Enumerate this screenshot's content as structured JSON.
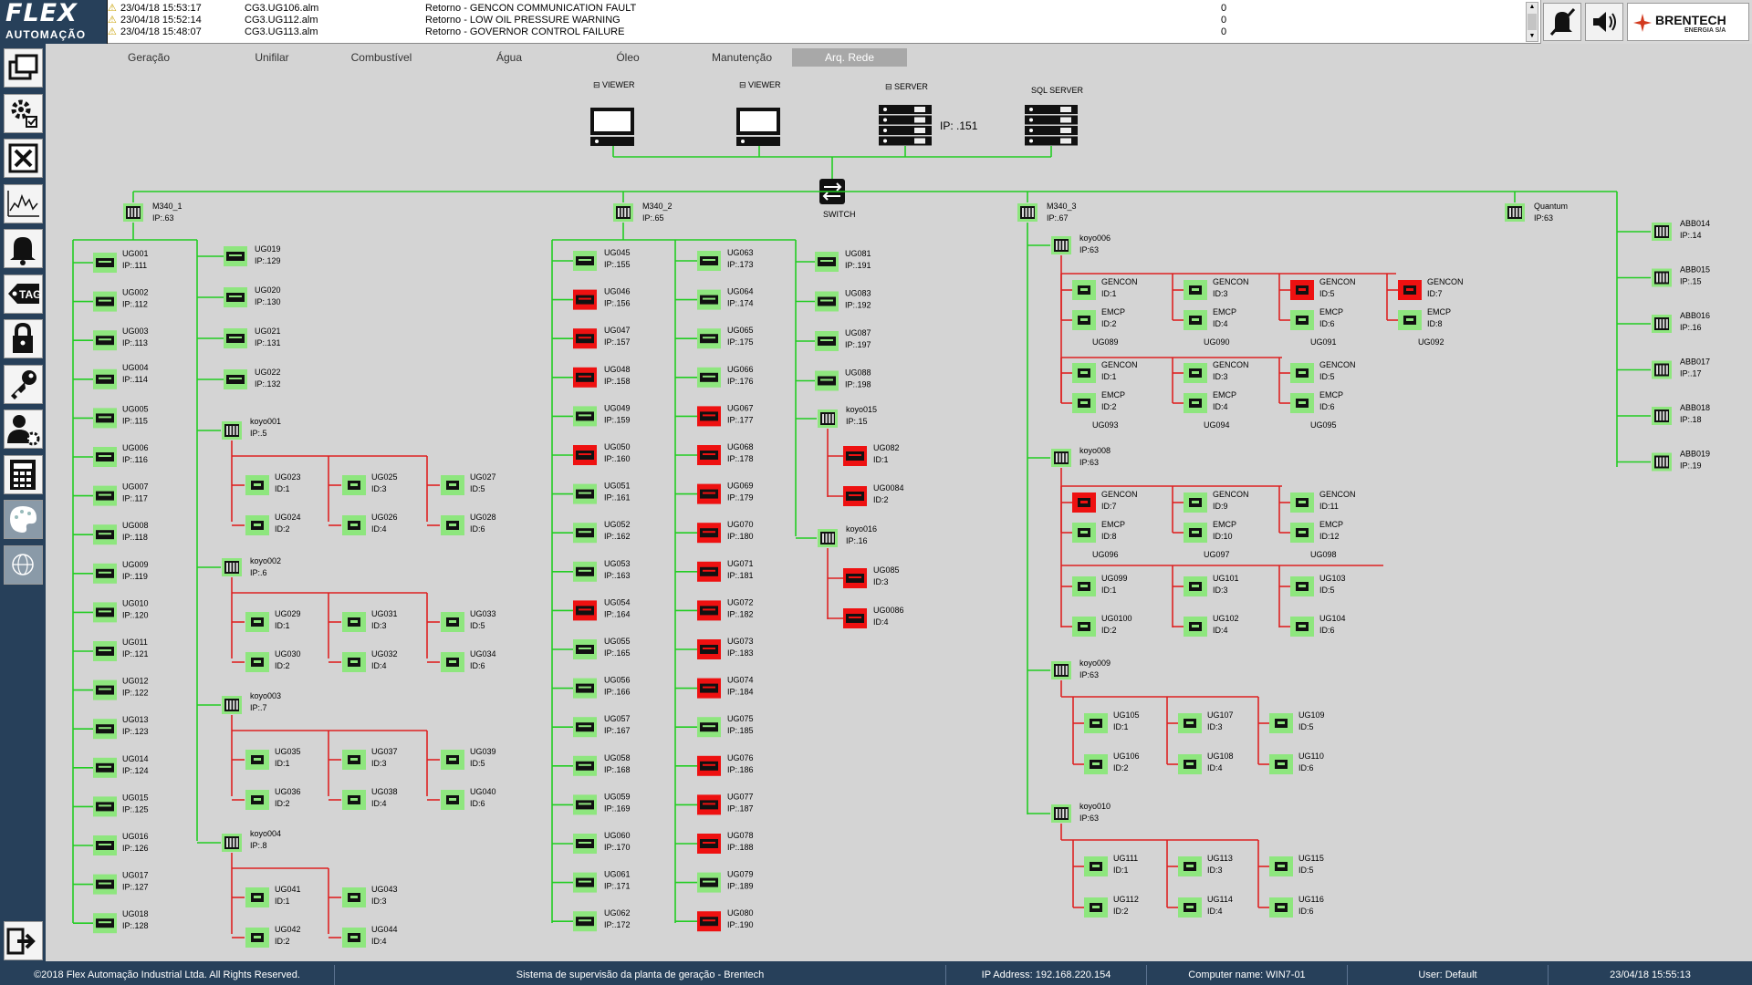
{
  "logo": {
    "line1": "FLEX",
    "line2": "AUTOMAÇÃO"
  },
  "alarms": [
    {
      "timestamp": "23/04/18 15:53:17",
      "tag": "CG3.UG106.alm",
      "message": "Retorno - GENCON COMMUNICATION FAULT",
      "value": "0"
    },
    {
      "timestamp": "23/04/18 15:52:14",
      "tag": "CG3.UG112.alm",
      "message": "Retorno - LOW OIL PRESSURE WARNING",
      "value": "0"
    },
    {
      "timestamp": "23/04/18 15:48:07",
      "tag": "CG3.UG113.alm",
      "message": "Retorno - GOVERNOR CONTROL FAILURE",
      "value": "0"
    }
  ],
  "brand": {
    "name": "BRENTECH",
    "sub": "ENERGIA S/A"
  },
  "tabs": [
    "Geração",
    "Unifilar",
    "Combustível",
    "Água",
    "Óleo",
    "Manutenção",
    "Arq. Rede"
  ],
  "active_tab": "Arq. Rede",
  "sidebar_icons": [
    "windows-icon",
    "gear-check-icon",
    "excel-icon",
    "trend-chart-icon",
    "bell-icon",
    "tag-icon",
    "lock-icon",
    "key-icon",
    "user-settings-icon",
    "calculator-icon",
    "palette-icon",
    "globe-icon",
    "exit-icon"
  ],
  "colors": {
    "ok": "#8ee67e",
    "fault": "#ee1111",
    "link_green": "#22cc22",
    "link_red": "#dd2222",
    "sidebar": "#27405a"
  },
  "servers": [
    {
      "label": "VIEWER",
      "kind": "viewer"
    },
    {
      "label": "VIEWER",
      "kind": "viewer"
    },
    {
      "label": "SERVER",
      "kind": "server",
      "ip": "IP: .151"
    },
    {
      "label": "SQL SERVER",
      "kind": "server"
    }
  ],
  "switch_label": "SWITCH",
  "plcs": [
    {
      "name": "M340_1",
      "ip": "IP:.63"
    },
    {
      "name": "M340_2",
      "ip": "IP:.65"
    },
    {
      "name": "M340_3",
      "ip": "IP:.67"
    },
    {
      "name": "Quantum",
      "ip": "IP:63"
    }
  ],
  "m340_1_units": [
    {
      "name": "UG001",
      "ip": "IP:.111",
      "status": "ok"
    },
    {
      "name": "UG002",
      "ip": "IP:.112",
      "status": "ok"
    },
    {
      "name": "UG003",
      "ip": "IP:.113",
      "status": "ok"
    },
    {
      "name": "UG004",
      "ip": "IP:.114",
      "status": "ok"
    },
    {
      "name": "UG005",
      "ip": "IP:.115",
      "status": "ok"
    },
    {
      "name": "UG006",
      "ip": "IP:.116",
      "status": "ok"
    },
    {
      "name": "UG007",
      "ip": "IP:.117",
      "status": "ok"
    },
    {
      "name": "UG008",
      "ip": "IP:.118",
      "status": "ok"
    },
    {
      "name": "UG009",
      "ip": "IP:.119",
      "status": "ok"
    },
    {
      "name": "UG010",
      "ip": "IP:.120",
      "status": "ok"
    },
    {
      "name": "UG011",
      "ip": "IP:.121",
      "status": "ok"
    },
    {
      "name": "UG012",
      "ip": "IP:.122",
      "status": "ok"
    },
    {
      "name": "UG013",
      "ip": "IP:.123",
      "status": "ok"
    },
    {
      "name": "UG014",
      "ip": "IP:.124",
      "status": "ok"
    },
    {
      "name": "UG015",
      "ip": "IP:.125",
      "status": "ok"
    },
    {
      "name": "UG016",
      "ip": "IP:.126",
      "status": "ok"
    },
    {
      "name": "UG017",
      "ip": "IP:.127",
      "status": "ok"
    },
    {
      "name": "UG018",
      "ip": "IP:.128",
      "status": "ok"
    }
  ],
  "m340_1_units_b": [
    {
      "name": "UG019",
      "ip": "IP:.129",
      "status": "ok"
    },
    {
      "name": "UG020",
      "ip": "IP:.130",
      "status": "ok"
    },
    {
      "name": "UG021",
      "ip": "IP:.131",
      "status": "ok"
    },
    {
      "name": "UG022",
      "ip": "IP:.132",
      "status": "ok"
    }
  ],
  "koyo_m1": [
    {
      "name": "koyo001",
      "ip": "IP:.5",
      "units": [
        {
          "name": "UG023",
          "id": "ID:1",
          "status": "ok"
        },
        {
          "name": "UG024",
          "id": "ID:2",
          "status": "ok"
        },
        {
          "name": "UG025",
          "id": "ID:3",
          "status": "ok"
        },
        {
          "name": "UG026",
          "id": "ID:4",
          "status": "ok"
        },
        {
          "name": "UG027",
          "id": "ID:5",
          "status": "ok"
        },
        {
          "name": "UG028",
          "id": "ID:6",
          "status": "ok"
        }
      ]
    },
    {
      "name": "koyo002",
      "ip": "IP:.6",
      "units": [
        {
          "name": "UG029",
          "id": "ID:1",
          "status": "ok"
        },
        {
          "name": "UG030",
          "id": "ID:2",
          "status": "ok"
        },
        {
          "name": "UG031",
          "id": "ID:3",
          "status": "ok"
        },
        {
          "name": "UG032",
          "id": "ID:4",
          "status": "ok"
        },
        {
          "name": "UG033",
          "id": "ID:5",
          "status": "ok"
        },
        {
          "name": "UG034",
          "id": "ID:6",
          "status": "ok"
        }
      ]
    },
    {
      "name": "koyo003",
      "ip": "IP:.7",
      "units": [
        {
          "name": "UG035",
          "id": "ID:1",
          "status": "ok"
        },
        {
          "name": "UG036",
          "id": "ID:2",
          "status": "ok"
        },
        {
          "name": "UG037",
          "id": "ID:3",
          "status": "ok"
        },
        {
          "name": "UG038",
          "id": "ID:4",
          "status": "ok"
        },
        {
          "name": "UG039",
          "id": "ID:5",
          "status": "ok"
        },
        {
          "name": "UG040",
          "id": "ID:6",
          "status": "ok"
        }
      ]
    },
    {
      "name": "koyo004",
      "ip": "IP:.8",
      "units": [
        {
          "name": "UG041",
          "id": "ID:1",
          "status": "ok"
        },
        {
          "name": "UG042",
          "id": "ID:2",
          "status": "ok"
        },
        {
          "name": "UG043",
          "id": "ID:3",
          "status": "ok"
        },
        {
          "name": "UG044",
          "id": "ID:4",
          "status": "ok"
        }
      ]
    }
  ],
  "m340_2_units_a": [
    {
      "name": "UG045",
      "ip": "IP:.155",
      "status": "ok"
    },
    {
      "name": "UG046",
      "ip": "IP:.156",
      "status": "fault"
    },
    {
      "name": "UG047",
      "ip": "IP:.157",
      "status": "fault"
    },
    {
      "name": "UG048",
      "ip": "IP:.158",
      "status": "fault"
    },
    {
      "name": "UG049",
      "ip": "IP:.159",
      "status": "ok"
    },
    {
      "name": "UG050",
      "ip": "IP:.160",
      "status": "fault"
    },
    {
      "name": "UG051",
      "ip": "IP:.161",
      "status": "ok"
    },
    {
      "name": "UG052",
      "ip": "IP:.162",
      "status": "ok"
    },
    {
      "name": "UG053",
      "ip": "IP:.163",
      "status": "ok"
    },
    {
      "name": "UG054",
      "ip": "IP:.164",
      "status": "fault"
    },
    {
      "name": "UG055",
      "ip": "IP:.165",
      "status": "ok"
    },
    {
      "name": "UG056",
      "ip": "IP:.166",
      "status": "ok"
    },
    {
      "name": "UG057",
      "ip": "IP:.167",
      "status": "ok"
    },
    {
      "name": "UG058",
      "ip": "IP:.168",
      "status": "ok"
    },
    {
      "name": "UG059",
      "ip": "IP:.169",
      "status": "ok"
    },
    {
      "name": "UG060",
      "ip": "IP:.170",
      "status": "ok"
    },
    {
      "name": "UG061",
      "ip": "IP:.171",
      "status": "ok"
    },
    {
      "name": "UG062",
      "ip": "IP:.172",
      "status": "ok"
    }
  ],
  "m340_2_units_b": [
    {
      "name": "UG063",
      "ip": "IP:.173",
      "status": "ok"
    },
    {
      "name": "UG064",
      "ip": "IP:.174",
      "status": "ok"
    },
    {
      "name": "UG065",
      "ip": "IP:.175",
      "status": "ok"
    },
    {
      "name": "UG066",
      "ip": "IP:.176",
      "status": "ok"
    },
    {
      "name": "UG067",
      "ip": "IP:.177",
      "status": "fault"
    },
    {
      "name": "UG068",
      "ip": "IP:.178",
      "status": "fault"
    },
    {
      "name": "UG069",
      "ip": "IP:.179",
      "status": "fault"
    },
    {
      "name": "UG070",
      "ip": "IP:.180",
      "status": "fault"
    },
    {
      "name": "UG071",
      "ip": "IP:.181",
      "status": "fault"
    },
    {
      "name": "UG072",
      "ip": "IP:.182",
      "status": "fault"
    },
    {
      "name": "UG073",
      "ip": "IP:.183",
      "status": "fault"
    },
    {
      "name": "UG074",
      "ip": "IP:.184",
      "status": "fault"
    },
    {
      "name": "UG075",
      "ip": "IP:.185",
      "status": "ok"
    },
    {
      "name": "UG076",
      "ip": "IP:.186",
      "status": "fault"
    },
    {
      "name": "UG077",
      "ip": "IP:.187",
      "status": "fault"
    },
    {
      "name": "UG078",
      "ip": "IP:.188",
      "status": "fault"
    },
    {
      "name": "UG079",
      "ip": "IP:.189",
      "status": "ok"
    },
    {
      "name": "UG080",
      "ip": "IP:.190",
      "status": "fault"
    }
  ],
  "m340_2_units_c": [
    {
      "name": "UG081",
      "ip": "IP:.191",
      "status": "ok"
    },
    {
      "name": "UG083",
      "ip": "IP:.192",
      "status": "ok"
    },
    {
      "name": "UG087",
      "ip": "IP:.197",
      "status": "ok"
    },
    {
      "name": "UG088",
      "ip": "IP:.198",
      "status": "ok"
    }
  ],
  "koyo_m2": [
    {
      "name": "koyo015",
      "ip": "IP:.15",
      "units": [
        {
          "name": "UG082",
          "id": "ID:1",
          "status": "fault"
        },
        {
          "name": "UG0084",
          "id": "ID:2",
          "status": "fault"
        }
      ]
    },
    {
      "name": "koyo016",
      "ip": "IP:.16",
      "units": [
        {
          "name": "UG085",
          "id": "ID:3",
          "status": "fault"
        },
        {
          "name": "UG0086",
          "id": "ID:4",
          "status": "fault"
        }
      ]
    }
  ],
  "koyo_m3": [
    {
      "name": "koyo006",
      "ip": "IP:63",
      "gencon_groups": [
        {
          "group": "UG089",
          "gencon": "GENCON",
          "gencon_id": "ID:1",
          "gencon_status": "ok",
          "emcp": "EMCP",
          "emcp_id": "ID:2",
          "emcp_status": "ok"
        },
        {
          "group": "UG090",
          "gencon": "GENCON",
          "gencon_id": "ID:3",
          "gencon_status": "ok",
          "emcp": "EMCP",
          "emcp_id": "ID:4",
          "emcp_status": "ok"
        },
        {
          "group": "UG091",
          "gencon": "GENCON",
          "gencon_id": "ID:5",
          "gencon_status": "fault",
          "emcp": "EMCP",
          "emcp_id": "ID:6",
          "emcp_status": "ok"
        },
        {
          "group": "UG092",
          "gencon": "GENCON",
          "gencon_id": "ID:7",
          "gencon_status": "fault",
          "emcp": "EMCP",
          "emcp_id": "ID:8",
          "emcp_status": "ok"
        },
        {
          "group": "UG093",
          "gencon": "GENCON",
          "gencon_id": "ID:1",
          "gencon_status": "ok",
          "emcp": "EMCP",
          "emcp_id": "ID:2",
          "emcp_status": "ok"
        },
        {
          "group": "UG094",
          "gencon": "GENCON",
          "gencon_id": "ID:3",
          "gencon_status": "ok",
          "emcp": "EMCP",
          "emcp_id": "ID:4",
          "emcp_status": "ok"
        },
        {
          "group": "UG095",
          "gencon": "GENCON",
          "gencon_id": "ID:5",
          "gencon_status": "ok",
          "emcp": "EMCP",
          "emcp_id": "ID:6",
          "emcp_status": "ok"
        }
      ]
    },
    {
      "name": "koyo008",
      "ip": "IP:63",
      "gencon_groups": [
        {
          "group": "UG096",
          "gencon": "GENCON",
          "gencon_id": "ID:7",
          "gencon_status": "fault",
          "emcp": "EMCP",
          "emcp_id": "ID:8",
          "emcp_status": "ok"
        },
        {
          "group": "UG097",
          "gencon": "GENCON",
          "gencon_id": "ID:9",
          "gencon_status": "ok",
          "emcp": "EMCP",
          "emcp_id": "ID:10",
          "emcp_status": "ok"
        },
        {
          "group": "UG098",
          "gencon": "GENCON",
          "gencon_id": "ID:11",
          "gencon_status": "ok",
          "emcp": "EMCP",
          "emcp_id": "ID:12",
          "emcp_status": "ok"
        }
      ],
      "units": [
        {
          "name": "UG099",
          "id": "ID:1",
          "status": "ok"
        },
        {
          "name": "UG0100",
          "id": "ID:2",
          "status": "ok"
        },
        {
          "name": "UG101",
          "id": "ID:3",
          "status": "ok"
        },
        {
          "name": "UG102",
          "id": "ID:4",
          "status": "ok"
        },
        {
          "name": "UG103",
          "id": "ID:5",
          "status": "ok"
        },
        {
          "name": "UG104",
          "id": "ID:6",
          "status": "ok"
        }
      ]
    },
    {
      "name": "koyo009",
      "ip": "IP:63",
      "units": [
        {
          "name": "UG105",
          "id": "ID:1",
          "status": "ok"
        },
        {
          "name": "UG106",
          "id": "ID:2",
          "status": "ok"
        },
        {
          "name": "UG107",
          "id": "ID:3",
          "status": "ok"
        },
        {
          "name": "UG108",
          "id": "ID:4",
          "status": "ok"
        },
        {
          "name": "UG109",
          "id": "ID:5",
          "status": "ok"
        },
        {
          "name": "UG110",
          "id": "ID:6",
          "status": "ok"
        }
      ]
    },
    {
      "name": "koyo010",
      "ip": "IP:63",
      "units": [
        {
          "name": "UG111",
          "id": "ID:1",
          "status": "ok"
        },
        {
          "name": "UG112",
          "id": "ID:2",
          "status": "ok"
        },
        {
          "name": "UG113",
          "id": "ID:3",
          "status": "ok"
        },
        {
          "name": "UG114",
          "id": "ID:4",
          "status": "ok"
        },
        {
          "name": "UG115",
          "id": "ID:5",
          "status": "ok"
        },
        {
          "name": "UG116",
          "id": "ID:6",
          "status": "ok"
        }
      ]
    }
  ],
  "quantum_units": [
    {
      "name": "ABB014",
      "ip": "IP:.14"
    },
    {
      "name": "ABB015",
      "ip": "IP:.15"
    },
    {
      "name": "ABB016",
      "ip": "IP:.16"
    },
    {
      "name": "ABB017",
      "ip": "IP:.17"
    },
    {
      "name": "ABB018",
      "ip": "IP:.18"
    },
    {
      "name": "ABB019",
      "ip": "IP:.19"
    }
  ],
  "status_bar": {
    "copyright": "©2018 Flex Automação Industrial Ltda. All Rights Reserved.",
    "system": "Sistema de supervisão da planta de geração - Brentech",
    "ip": "IP Address: 192.168.220.154",
    "computer": "Computer name: WIN7-01",
    "user": "User: Default",
    "datetime": "23/04/18 15:55:13"
  }
}
